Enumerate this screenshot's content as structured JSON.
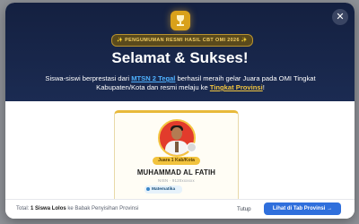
{
  "header": {
    "announcement": "✨ PENGUMUMAN RESMI HASIL CBT OMI 2026 ✨",
    "title": "Selamat & Sukses!",
    "desc_part1": "Siswa-siswi berprestasi dari ",
    "school": "MTSN 2 Tegal",
    "desc_part2": " berhasil meraih gelar Juara pada OMI Tingkat Kabupaten/Kota dan resmi melaju ke ",
    "level": "Tingkat Provinsi",
    "desc_part3": "!",
    "close_symbol": "✕"
  },
  "card": {
    "badge": "Juara 1 Kab/Kota",
    "name": "MUHAMMAD AL FATIH",
    "nisn": "NISN · 9120xxxxxx",
    "subject": "Matematika"
  },
  "footer": {
    "total_prefix": "Total: ",
    "total_count": "1 Siswa Lolos",
    "total_suffix": " ke Babak Penyisihan Provinsi",
    "close_label": "Tutup",
    "primary_label": "Lihat di Tab Provinsi →"
  }
}
